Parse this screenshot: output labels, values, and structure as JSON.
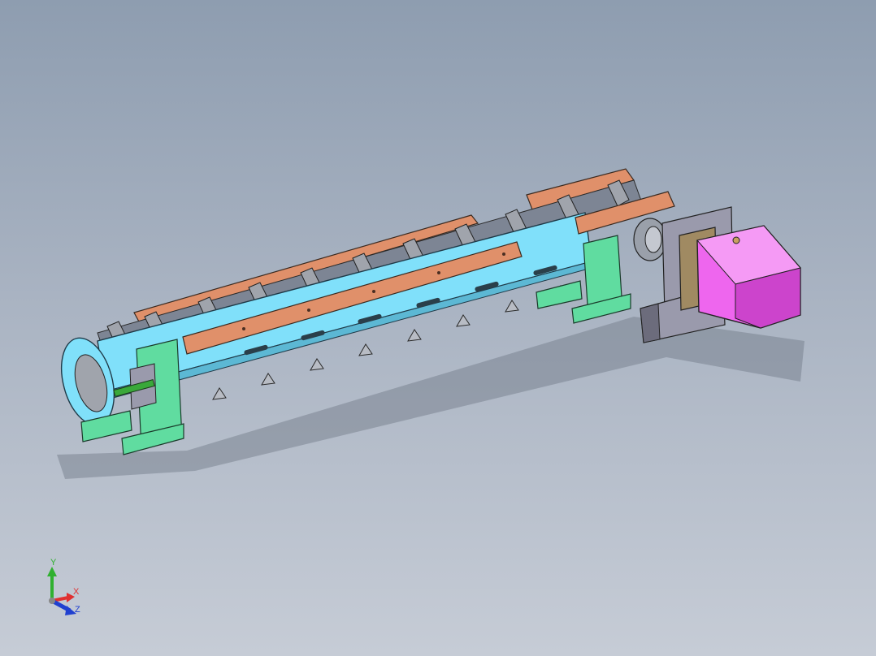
{
  "viewport": {
    "background_top": "#8e9db0",
    "background_bottom": "#c6ccd6"
  },
  "model": {
    "frame_color": "#80e0fa",
    "guard_color": "#e0906a",
    "support_color": "#60dca0",
    "flight_color": "#a0a4ac",
    "motor_color": "#ee66ee",
    "gearbox_color": "#a08a62",
    "mount_color": "#9a9aac"
  },
  "triad": {
    "x_label": "X",
    "y_label": "Y",
    "z_label": "Z",
    "x_color": "#e03030",
    "y_color": "#30b030",
    "z_color": "#2040d0"
  }
}
